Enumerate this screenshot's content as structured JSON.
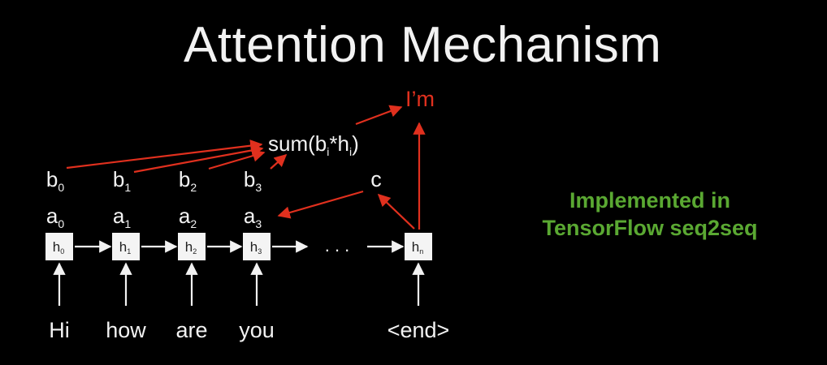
{
  "title": "Attention Mechanism",
  "colors": {
    "background": "#000000",
    "text": "#f2f2f2",
    "attention_arrows": "#e0301e",
    "note": "#5aa832"
  },
  "inputs": [
    "Hi",
    "how",
    "are",
    "you",
    "<end>"
  ],
  "hidden_states": [
    {
      "base": "h",
      "sub": "0"
    },
    {
      "base": "h",
      "sub": "1"
    },
    {
      "base": "h",
      "sub": "2"
    },
    {
      "base": "h",
      "sub": "3"
    },
    {
      "base": "h",
      "sub": "n"
    }
  ],
  "ellipsis": ". . .",
  "a_labels": [
    {
      "base": "a",
      "sub": "0"
    },
    {
      "base": "a",
      "sub": "1"
    },
    {
      "base": "a",
      "sub": "2"
    },
    {
      "base": "a",
      "sub": "3"
    }
  ],
  "b_labels": [
    {
      "base": "b",
      "sub": "0"
    },
    {
      "base": "b",
      "sub": "1"
    },
    {
      "base": "b",
      "sub": "2"
    },
    {
      "base": "b",
      "sub": "3"
    }
  ],
  "sum_label": {
    "prefix": "sum(b",
    "sub1": "i",
    "mid": "*h",
    "sub2": "i",
    "suffix": ")"
  },
  "context_label": "c",
  "output_label": "I’m",
  "note": {
    "line1": "Implemented in",
    "line2": "TensorFlow seq2seq"
  }
}
